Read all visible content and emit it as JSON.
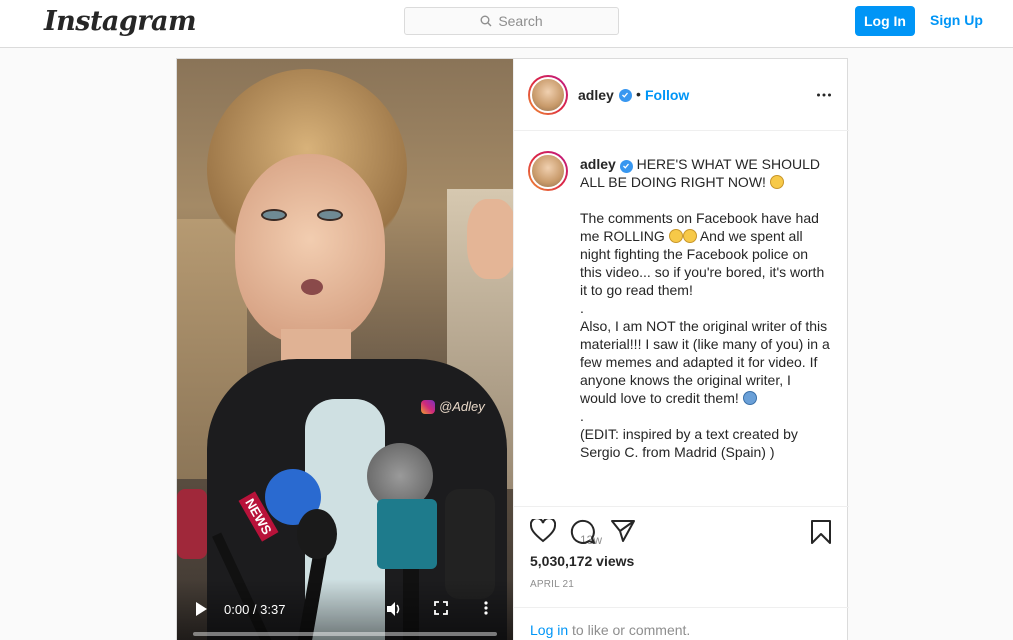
{
  "header": {
    "logo": "Instagram",
    "search_placeholder": "Search",
    "login_label": "Log In",
    "signup_label": "Sign Up"
  },
  "video": {
    "time": "0:00 / 3:37",
    "watermark": "@Adley",
    "news_text": "NEWS",
    "progress": 0
  },
  "post": {
    "username": "adley",
    "dot": "•",
    "follow_label": "Follow",
    "caption_username": "adley",
    "caption_lines": [
      "HERE'S WHAT WE SHOULD ALL BE DOING RIGHT NOW!",
      "The comments on Facebook have had me ROLLING",
      "And we spent all night fighting the Facebook police on this video... so if you're bored, it's worth it to go read them!",
      ".",
      "Also, I am NOT the original writer of this material!!! I saw it (like many of you) in a few memes and adapted it for video. If anyone knows the original writer, I would love to credit them!",
      ".",
      "(EDIT: inspired by a text created by Sergio C. from Madrid (Spain) )"
    ],
    "time_ago": "13w",
    "views": "5,030,172 views",
    "date": "APRIL 21",
    "login_link": "Log in",
    "login_rest": " to like or comment."
  },
  "colors": {
    "accent": "#0095f6",
    "verified": "#3897f0",
    "border": "#dbdbdb"
  },
  "icons": [
    "search-icon",
    "verified-icon",
    "more-icon",
    "heart-icon",
    "comment-icon",
    "share-icon",
    "save-icon",
    "play-icon",
    "volume-icon",
    "fullscreen-icon"
  ]
}
